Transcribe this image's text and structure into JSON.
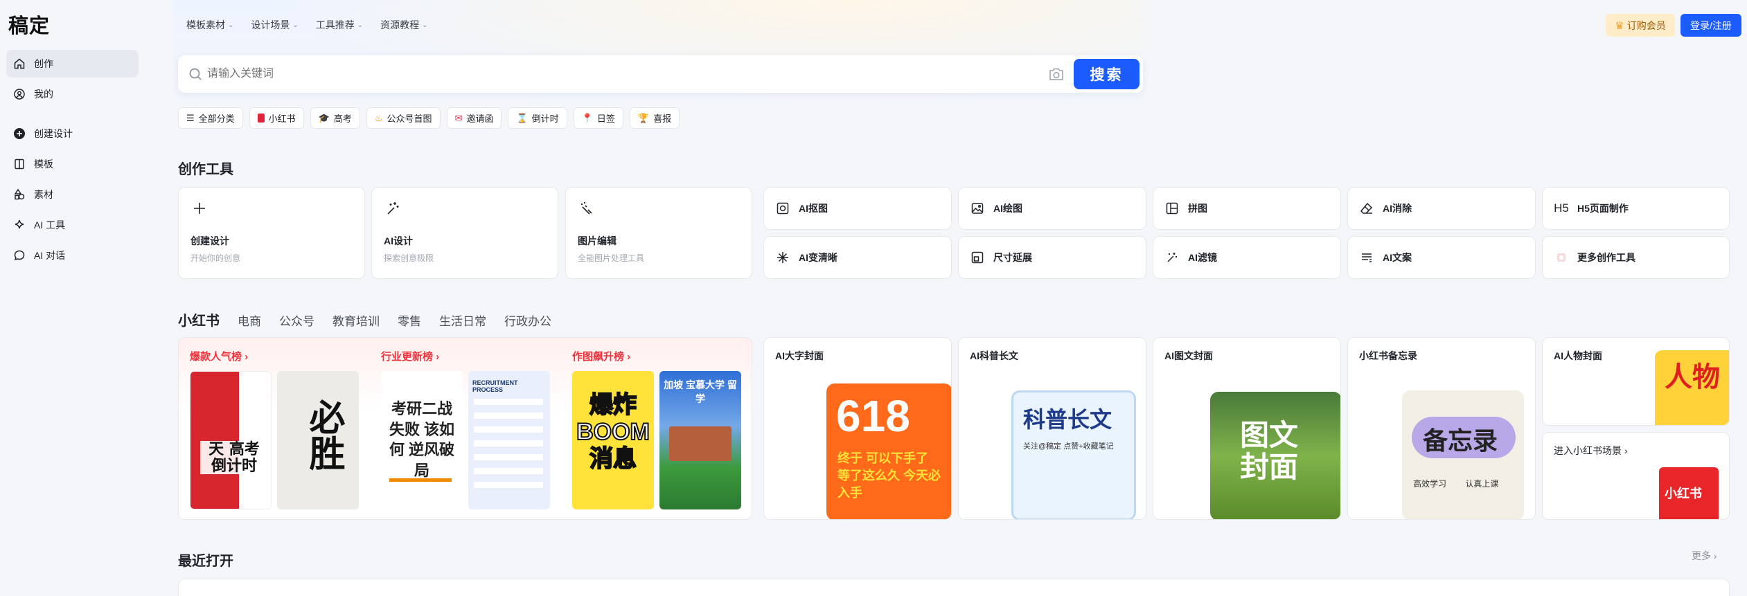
{
  "app": {
    "logo": "稿定"
  },
  "sidebar": {
    "items": [
      {
        "label": "创作",
        "icon": "home-icon"
      },
      {
        "label": "我的",
        "icon": "user-icon"
      },
      {
        "label": "创建设计",
        "icon": "plus-circle-icon"
      },
      {
        "label": "模板",
        "icon": "template-icon"
      },
      {
        "label": "素材",
        "icon": "shapes-icon"
      },
      {
        "label": "AI 工具",
        "icon": "sparkle-icon"
      },
      {
        "label": "AI 对话",
        "icon": "chat-icon"
      }
    ]
  },
  "topnav": [
    "模板素材",
    "设计场景",
    "工具推荐",
    "资源教程"
  ],
  "header": {
    "vip_label": "订购会员",
    "login_label": "登录/注册"
  },
  "search": {
    "placeholder": "请输入关键词",
    "button_label": "搜索"
  },
  "chips": [
    {
      "label": "全部分类",
      "icon": "list-icon"
    },
    {
      "label": "小红书",
      "icon": "red-book-icon"
    },
    {
      "label": "高考",
      "icon": "graduation-cap-icon"
    },
    {
      "label": "公众号首图",
      "icon": "flame-icon"
    },
    {
      "label": "邀请函",
      "icon": "envelope-icon"
    },
    {
      "label": "倒计时",
      "icon": "hourglass-icon"
    },
    {
      "label": "日签",
      "icon": "pin-icon"
    },
    {
      "label": "喜报",
      "icon": "trophy-icon"
    }
  ],
  "tools_section": {
    "title": "创作工具",
    "big": [
      {
        "title": "创建设计",
        "desc": "开始你的创意",
        "icon": "plus-icon"
      },
      {
        "title": "AI设计",
        "desc": "探索创意极限",
        "icon": "magic-wand-icon"
      },
      {
        "title": "图片编辑",
        "desc": "全能图片处理工具",
        "icon": "image-edit-icon"
      }
    ],
    "small": [
      {
        "label": "AI抠图",
        "icon": "cutout-icon"
      },
      {
        "label": "AI绘图",
        "icon": "image-draw-icon"
      },
      {
        "label": "拼图",
        "icon": "collage-icon"
      },
      {
        "label": "AI消除",
        "icon": "eraser-icon"
      },
      {
        "label": "H5页面制作",
        "icon": "h5-icon"
      },
      {
        "label": "AI变清晰",
        "icon": "sparkle-icon"
      },
      {
        "label": "尺寸延展",
        "icon": "resize-icon"
      },
      {
        "label": "AI滤镜",
        "icon": "filter-wand-icon"
      },
      {
        "label": "AI文案",
        "icon": "text-lines-icon"
      },
      {
        "label": "更多创作工具",
        "icon": "more-tools-icon"
      }
    ]
  },
  "categories": {
    "active": "小红书",
    "items": [
      "电商",
      "公众号",
      "教育培训",
      "零售",
      "生活日常",
      "行政办公"
    ]
  },
  "rankings": [
    {
      "title": "爆款人气榜",
      "thumbs": [
        "天 高考 倒计时",
        "必胜"
      ]
    },
    {
      "title": "行业更新榜",
      "thumbs": [
        "考研二战 失败 该如何 逆风破局",
        "RECRUITMENT PROCESS"
      ]
    },
    {
      "title": "作图飙升榜",
      "thumbs": [
        "爆炸 BOOM 消息",
        "加坡 宝慕大学 留学"
      ]
    }
  ],
  "template_cards": [
    {
      "title": "AI大字封面",
      "art": "618",
      "art_sub": "终于 可以下手了 等了这么久 今天必入手"
    },
    {
      "title": "AI科普长文",
      "art": "科普长文",
      "art_sub": "关注@稿定 点赞+收藏笔记"
    },
    {
      "title": "AI图文封面",
      "art": "图文 封面",
      "art_sub": ""
    },
    {
      "title": "小红书备忘录",
      "art": "备忘录",
      "art_sub": "高效学习 认真上课"
    },
    {
      "title": "AI人物封面",
      "art": "人物",
      "art_sub": ""
    }
  ],
  "scene_link": {
    "label": "进入小红书场景",
    "art": "小红书"
  },
  "recent": {
    "title": "最近打开",
    "more_label": "更多"
  },
  "colors": {
    "primary": "#1c5cff",
    "rank_red": "#f0323c",
    "vip_bg": "#ffedc9"
  }
}
